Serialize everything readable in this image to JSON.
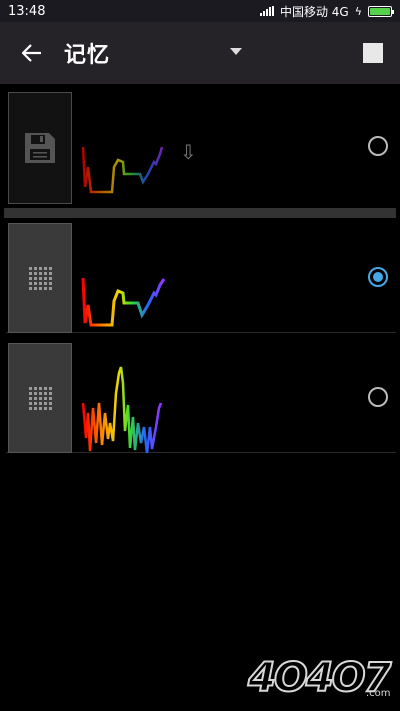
{
  "status_bar": {
    "time": "13:48",
    "carrier": "中国移动 4G",
    "battery_color": "#54d34a"
  },
  "app_bar": {
    "title": "记忆",
    "back_icon": "arrow-left-icon",
    "dropdown_icon": "triangle-down-icon",
    "stop_icon": "stop-square-icon"
  },
  "rows": [
    {
      "kind": "save",
      "icon": "floppy-disk-icon",
      "selected": false,
      "has_import_arrow": true
    },
    {
      "kind": "preset",
      "icon": "grid-dots-icon",
      "selected": true
    },
    {
      "kind": "preset",
      "icon": "grid-dots-icon",
      "selected": false
    }
  ],
  "accent_color": "#46a9e6",
  "watermark": {
    "main": "4O4O7",
    "suffix": ".com"
  }
}
